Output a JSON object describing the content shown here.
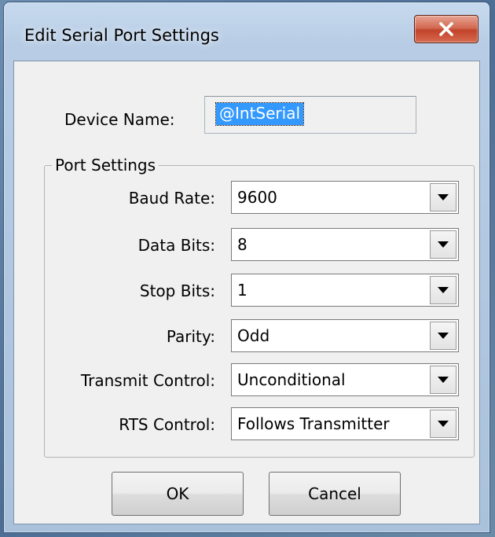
{
  "window": {
    "title": "Edit Serial Port Settings"
  },
  "device": {
    "label": "Device Name:",
    "value": "@IntSerial"
  },
  "port_settings": {
    "legend": "Port Settings",
    "fields": [
      {
        "label": "Baud Rate:",
        "value": "9600"
      },
      {
        "label": "Data Bits:",
        "value": "8"
      },
      {
        "label": "Stop Bits:",
        "value": "1"
      },
      {
        "label": "Parity:",
        "value": "Odd"
      },
      {
        "label": "Transmit Control:",
        "value": "Unconditional"
      },
      {
        "label": "RTS Control:",
        "value": "Follows Transmitter"
      }
    ]
  },
  "buttons": {
    "ok": "OK",
    "cancel": "Cancel"
  },
  "colors": {
    "selection": "#3399ff",
    "close_button": "#c1432a",
    "dialog_background": "#f0f0f0"
  }
}
